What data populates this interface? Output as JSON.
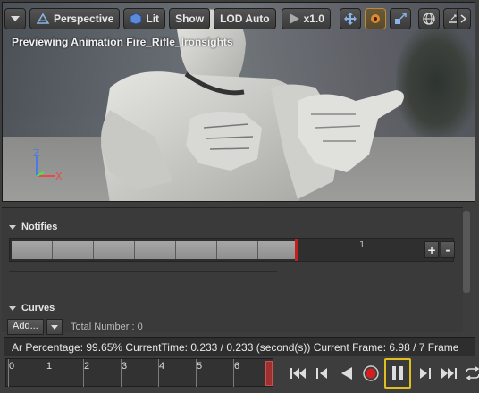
{
  "toolbar": {
    "perspective": "Perspective",
    "lit": "Lit",
    "show": "Show",
    "lod": "LOD Auto",
    "speed": "x1.0"
  },
  "viewport": {
    "caption": "Previewing Animation Fire_Rifle_Ironsights",
    "axis_z": "Z",
    "axis_x": "X"
  },
  "notifies": {
    "header": "Notifies",
    "track_number": "1",
    "plus": "+",
    "minus": "-"
  },
  "curves": {
    "header": "Curves",
    "add_label": "Add...",
    "total_number": "Total Number : 0"
  },
  "status": {
    "text": "Ar Percentage:  99.65% CurrentTime:  0.233 / 0.233 (second(s)) Current Frame:  6.98 / 7 Frame"
  },
  "timeline": {
    "ticks": [
      "0",
      "1",
      "2",
      "3",
      "4",
      "5",
      "6"
    ]
  }
}
